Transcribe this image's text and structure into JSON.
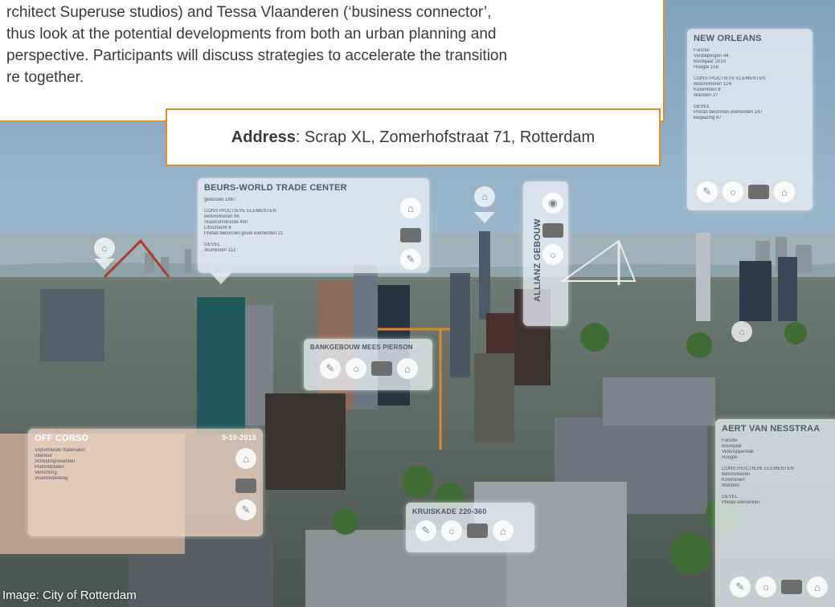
{
  "quote": {
    "line1": "rchitect Superuse studios) and Tessa Vlaanderen (‘business connector’,",
    "line2": " thus look at the potential developments from both an urban planning and",
    "line3": "perspective. Participants will discuss strategies to accelerate the transition",
    "line4": "re together."
  },
  "address": {
    "label": "Address",
    "value": ": Scrap XL, Zomerhofstraat 71, Rotterdam"
  },
  "caption": "Image: City of Rotterdam",
  "panels": {
    "new_orleans": {
      "title": "NEW ORLEANS",
      "lines": [
        "Functie",
        "Verdiepingen            44",
        "Bouwjaar            2010",
        "Hoogte             158",
        "",
        "CONSTRUCTIEVE ELEMENTEN",
        "Betonvloeren            124",
        "Kolommen              8",
        "Wanden                27",
        "",
        "GEVEL",
        "Prefab betonnen elementen   147",
        "Beglazing               87"
      ]
    },
    "beurs": {
      "title": "BEURS-WORLD TRADE CENTER",
      "lines": [
        "gebouwd           1987",
        "",
        "CONSTRUCTIEVE ELEMENTEN",
        "Betonvloeren                 96",
        "Staalconstructie            400",
        "Liftschacht                    6",
        "Prefab betonnen gevel elementen   21",
        "",
        "GEVEL",
        "Aluminium          112"
      ]
    },
    "allianz": {
      "title": "ALLIANZ GEBOUW"
    },
    "bank": {
      "title": "BANKGEBOUW MEES PIERSON"
    },
    "off": {
      "title": "OFF CORSO",
      "date": "9-10-2015",
      "lines": [
        "Vrijkomende materialen",
        "Interieur",
        "Scheidingswanden",
        "Plafondplaten",
        "Verlichting",
        "Vloerbedekking"
      ]
    },
    "kruiskade": {
      "title": "KRUISKADE 220-360"
    },
    "aert": {
      "title": "AERT VAN NESSTRAA",
      "lines": [
        "Functie",
        "Bouwjaar",
        "Vloeroppervlak",
        "Hoogte",
        "",
        "CONSTRUCTIEVE ELEMENTEN",
        "Betonvloeren",
        "Kolommen",
        "Wanden",
        "",
        "GEVEL",
        "Prefab elementen"
      ]
    }
  },
  "colors": {
    "accent_orange": "#e98a2b",
    "panel_title": "#4d5b6a",
    "text": "#3a3a3a"
  }
}
